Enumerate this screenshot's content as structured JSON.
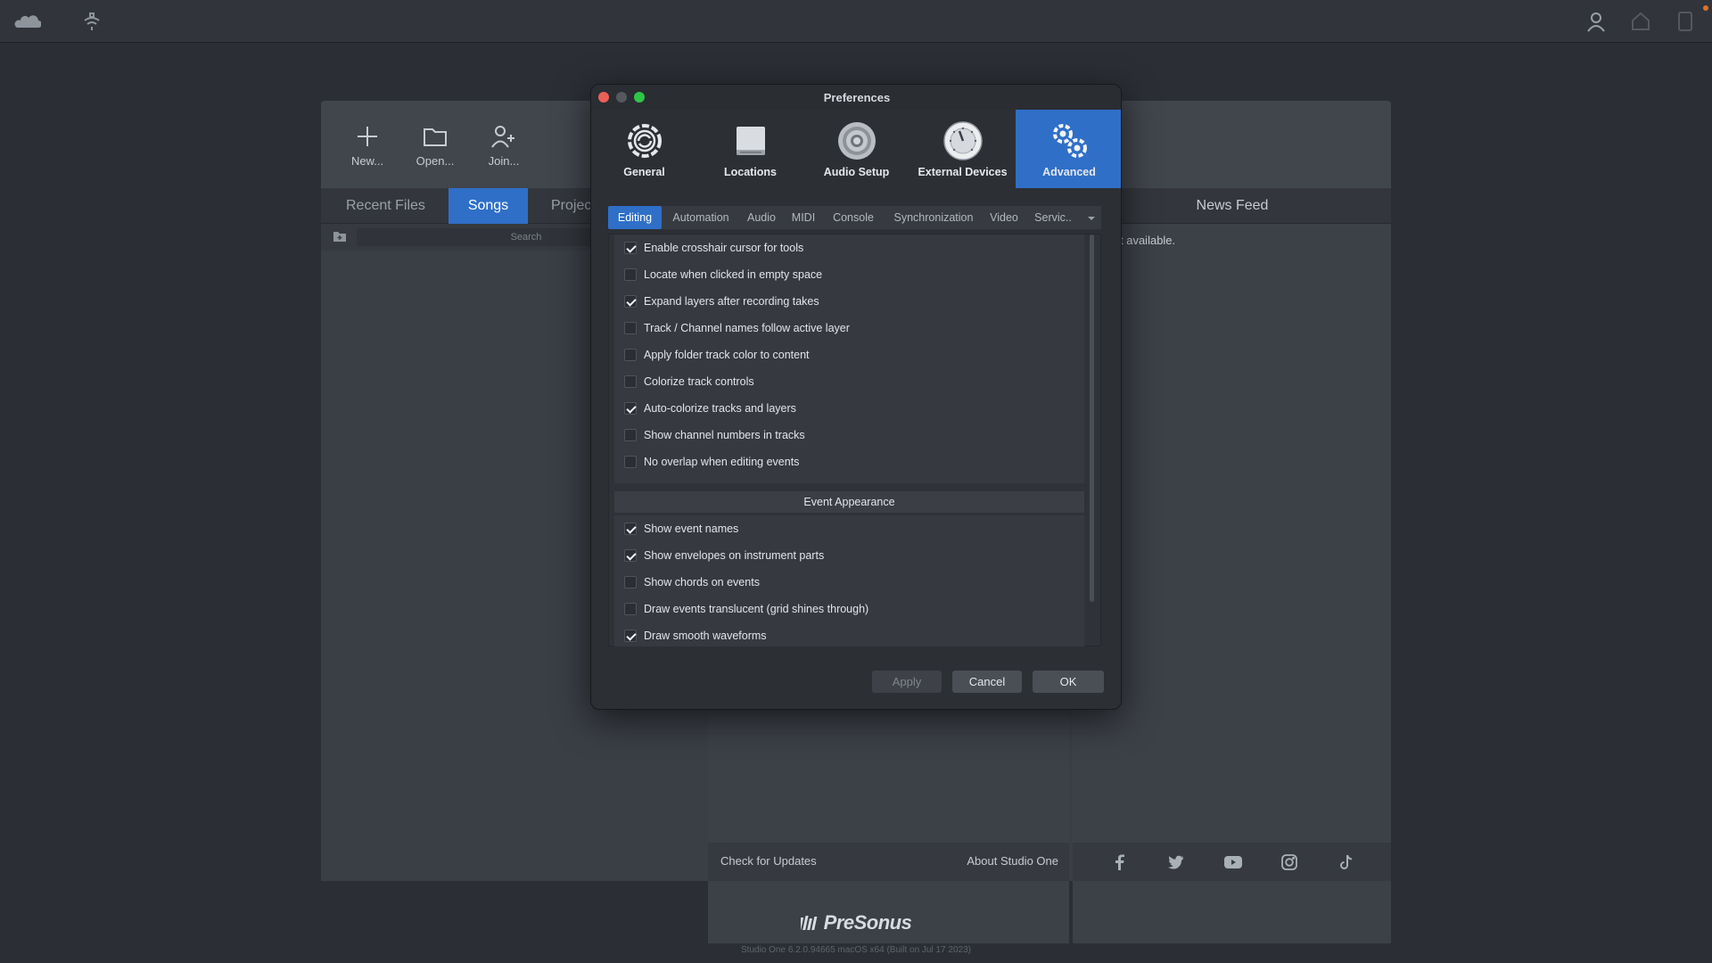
{
  "topbar": {
    "icons": [
      "cloud-icon",
      "antenna-icon",
      "user-icon",
      "home-icon",
      "tablet-icon"
    ],
    "notif_color": "#e0702c"
  },
  "startpage": {
    "actions": [
      {
        "label": "New...",
        "icon": "plus-icon"
      },
      {
        "label": "Open...",
        "icon": "folder-icon"
      },
      {
        "label": "Join...",
        "icon": "add-user-icon"
      }
    ],
    "tabs": [
      "Recent Files",
      "Songs",
      "Projec"
    ],
    "active_tab": "Songs",
    "search_placeholder": "Search",
    "news_feed_title": "News Feed",
    "news_feed_message": "t available.",
    "footer": {
      "check_updates": "Check for Updates",
      "about": "About Studio One"
    },
    "social_icons": [
      "facebook-icon",
      "twitter-icon",
      "youtube-icon",
      "instagram-icon",
      "tiktok-icon"
    ]
  },
  "brand": {
    "name": "PreSonus",
    "version": "Studio One 6.2.0.94665 macOS x64 (Built on Jul 17 2023)"
  },
  "dialog": {
    "title": "Preferences",
    "categories": [
      {
        "label": "General",
        "icon": "gear-refresh-icon"
      },
      {
        "label": "Locations",
        "icon": "drive-icon"
      },
      {
        "label": "Audio Setup",
        "icon": "speaker-icon"
      },
      {
        "label": "External Devices",
        "icon": "knob-icon"
      },
      {
        "label": "Advanced",
        "icon": "gears-icon"
      }
    ],
    "active_category": "Advanced",
    "subtabs": [
      "Editing",
      "Automation",
      "Audio",
      "MIDI",
      "Console",
      "Synchronization",
      "Video",
      "Servic.."
    ],
    "active_subtab": "Editing",
    "editing_options": [
      {
        "label": "Enable crosshair cursor for tools",
        "checked": true
      },
      {
        "label": "Locate when clicked in empty space",
        "checked": false
      },
      {
        "label": "Expand layers after recording takes",
        "checked": true
      },
      {
        "label": "Track / Channel names follow active layer",
        "checked": false
      },
      {
        "label": "Apply folder track color to content",
        "checked": false
      },
      {
        "label": "Colorize track controls",
        "checked": false
      },
      {
        "label": "Auto-colorize tracks and layers",
        "checked": true
      },
      {
        "label": "Show channel numbers in tracks",
        "checked": false
      },
      {
        "label": "No overlap when editing events",
        "checked": false
      }
    ],
    "event_appearance_title": "Event Appearance",
    "event_options": [
      {
        "label": "Show event names",
        "checked": true
      },
      {
        "label": "Show envelopes on instrument parts",
        "checked": true
      },
      {
        "label": "Show chords on events",
        "checked": false
      },
      {
        "label": "Draw events translucent (grid shines through)",
        "checked": false
      },
      {
        "label": "Draw smooth waveforms",
        "checked": true
      }
    ],
    "buttons": {
      "apply": "Apply",
      "cancel": "Cancel",
      "ok": "OK"
    },
    "accent_color": "#2f6fc8"
  }
}
